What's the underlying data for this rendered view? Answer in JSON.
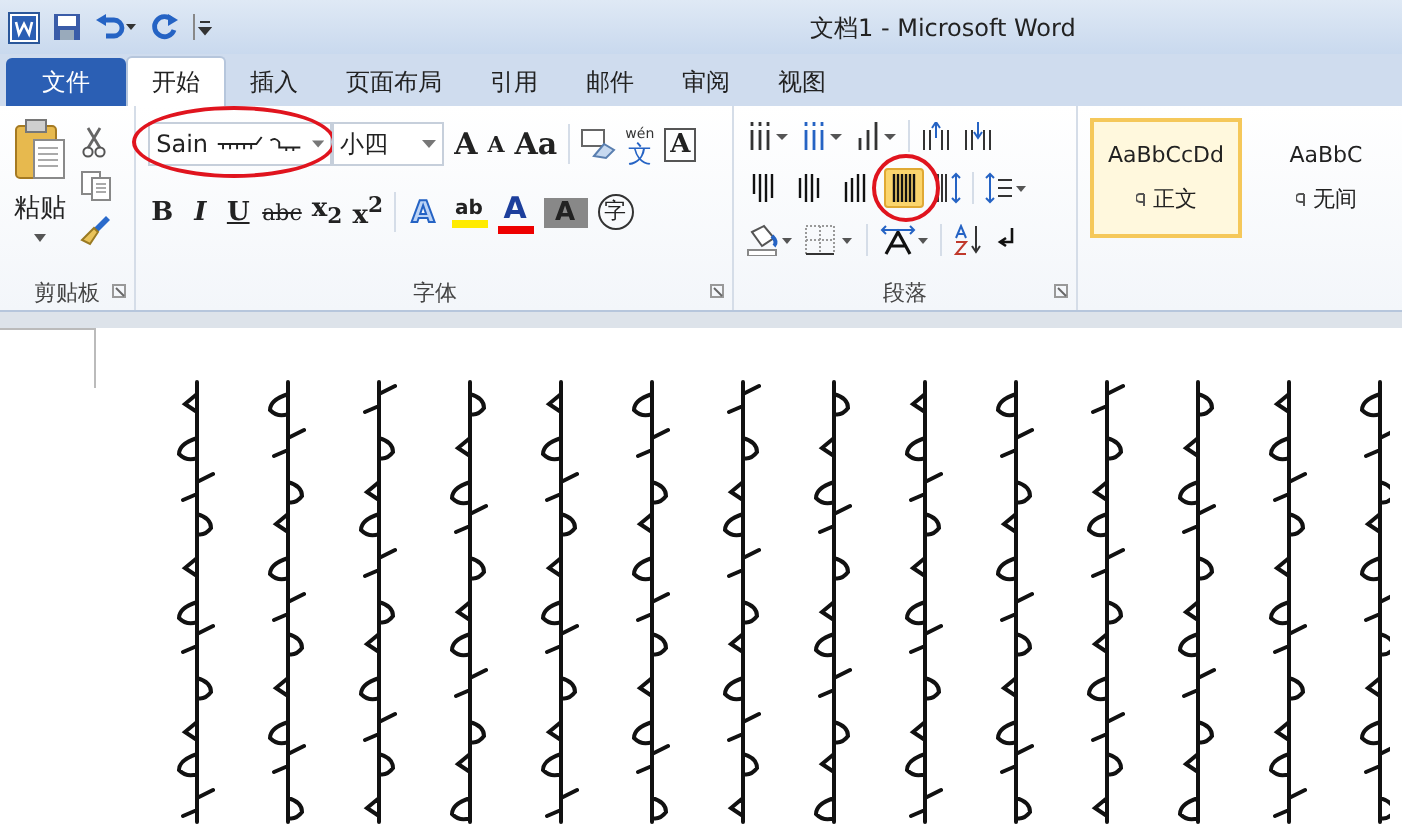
{
  "window": {
    "title": "文档1  -  Microsoft Word"
  },
  "tabs": [
    {
      "label": "文件",
      "kind": "file",
      "selected": false
    },
    {
      "label": "开始",
      "kind": "tab",
      "selected": true
    },
    {
      "label": "插入",
      "kind": "tab",
      "selected": false
    },
    {
      "label": "页面布局",
      "kind": "tab",
      "selected": false
    },
    {
      "label": "引用",
      "kind": "tab",
      "selected": false
    },
    {
      "label": "邮件",
      "kind": "tab",
      "selected": false
    },
    {
      "label": "审阅",
      "kind": "tab",
      "selected": false
    },
    {
      "label": "视图",
      "kind": "tab",
      "selected": false
    }
  ],
  "clipboard": {
    "paste_label": "粘贴",
    "group_label": "剪贴板"
  },
  "font": {
    "name_box": {
      "value": "Sain",
      "circled": true
    },
    "size_box": {
      "value": "小四"
    },
    "row1": [
      "A",
      "A",
      "Aa"
    ],
    "phonetic": {
      "pinyin": "wén",
      "char": "文"
    },
    "border_char": "A",
    "row2": [
      {
        "label": "B",
        "kind": "bold"
      },
      {
        "label": "I",
        "kind": "italic"
      },
      {
        "label": "U",
        "kind": "underline"
      },
      {
        "label": "abc",
        "kind": "strike"
      },
      {
        "label": "x$_{2}$",
        "kind": "plain"
      },
      {
        "label": "x$^{2}$",
        "kind": "plain"
      }
    ],
    "effects": [
      {
        "label": "A",
        "kind": "effect"
      },
      {
        "label": "ab",
        "kind": "highlight"
      },
      {
        "label": "A",
        "kind": "color"
      },
      {
        "label": "A",
        "kind": "shade"
      },
      {
        "label": "字",
        "kind": "enclose"
      }
    ],
    "group_label": "字体"
  },
  "paragraph": {
    "direction_buttons": [
      {
        "selected": false,
        "circled": false
      },
      {
        "selected": false,
        "circled": false
      },
      {
        "selected": false,
        "circled": false
      },
      {
        "selected": true,
        "circled": true
      }
    ],
    "group_label": "段落"
  },
  "styles": [
    {
      "preview": "AaBbCcDd",
      "name": "正文",
      "selected": true
    },
    {
      "preview": "AaBbC",
      "name": "无间",
      "selected": false
    }
  ]
}
